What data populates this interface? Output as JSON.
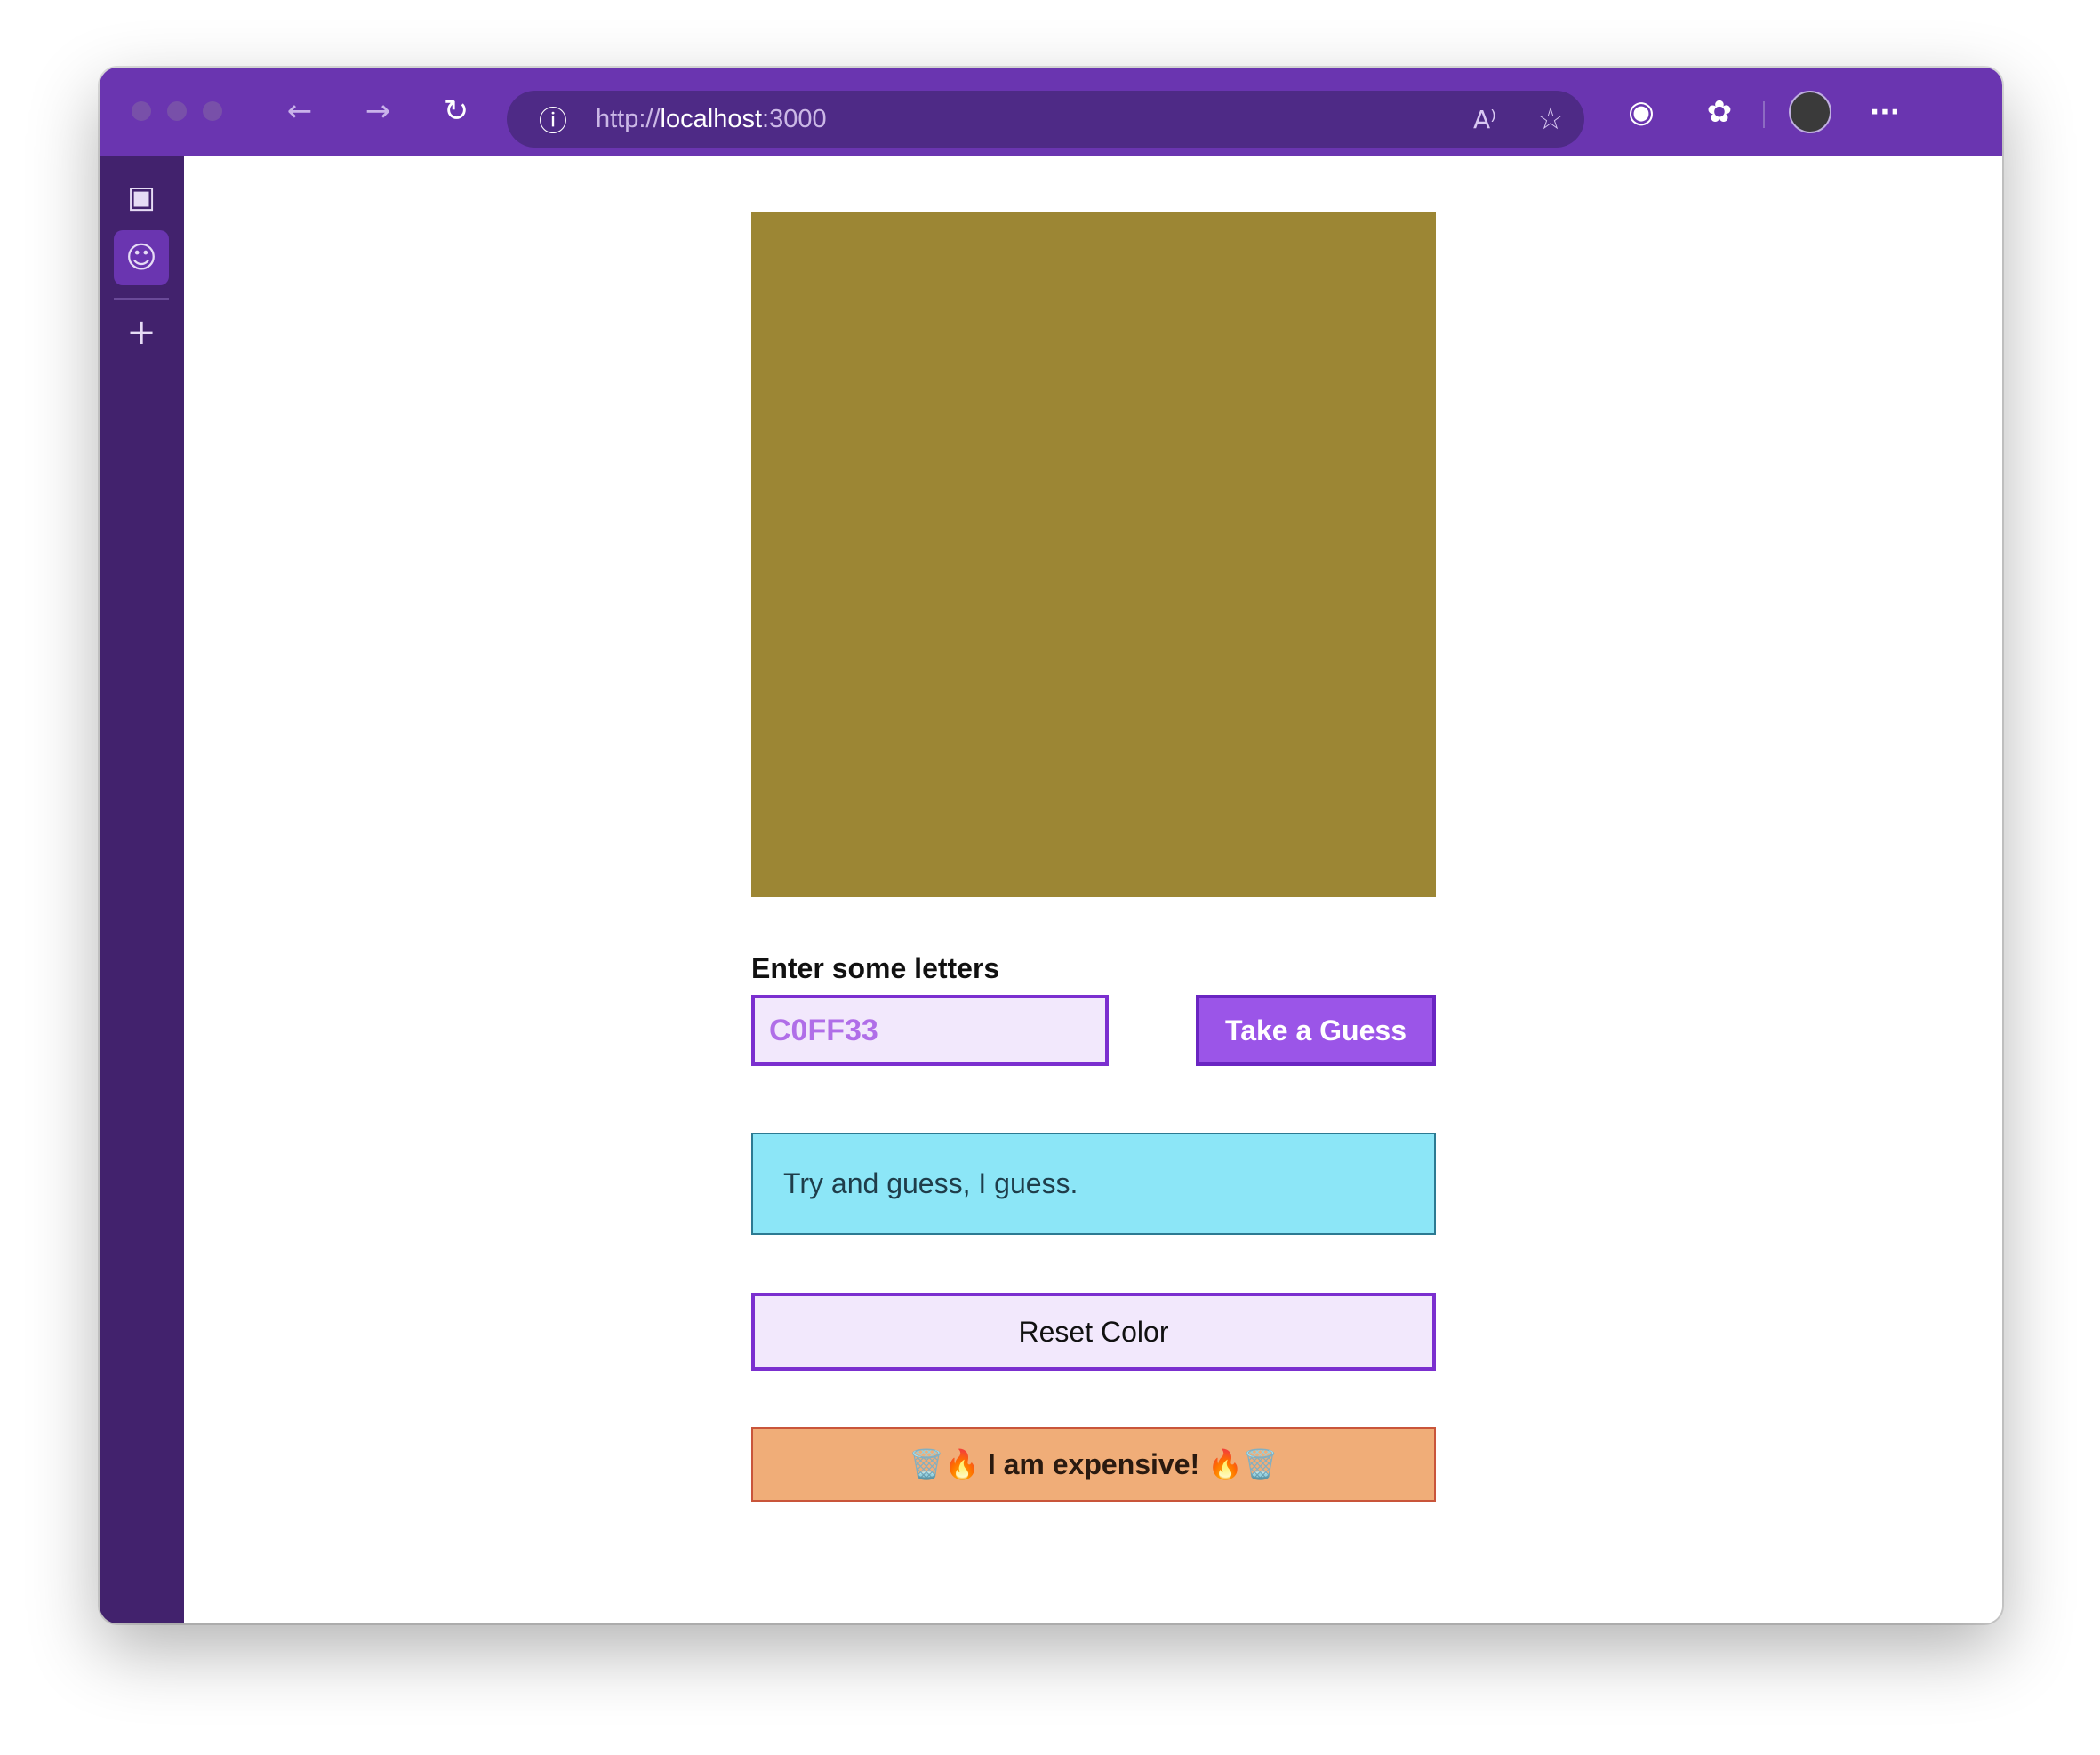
{
  "browser": {
    "url_scheme": "http://",
    "url_host": "localhost",
    "url_port": ":3000",
    "back_icon": "←",
    "forward_icon": "→",
    "reload_icon": "↻",
    "info_icon": "ⓘ",
    "read_aloud_icon": "A⁾",
    "favorite_icon": "☆",
    "password_icon": "◉",
    "extensions_icon": "✿",
    "more_icon": "···"
  },
  "sidebar": {
    "tabs_icon": "▣",
    "app_icon": "☺",
    "add_icon": "+"
  },
  "game": {
    "swatch_color": "#9c8634",
    "input_label": "Enter some letters",
    "input_value": "C0FF33",
    "guess_button": "Take a Guess",
    "status_message": "Try and guess, I guess.",
    "reset_button": "Reset Color",
    "expensive_button": "🗑️🔥 I am expensive! 🔥🗑️"
  }
}
